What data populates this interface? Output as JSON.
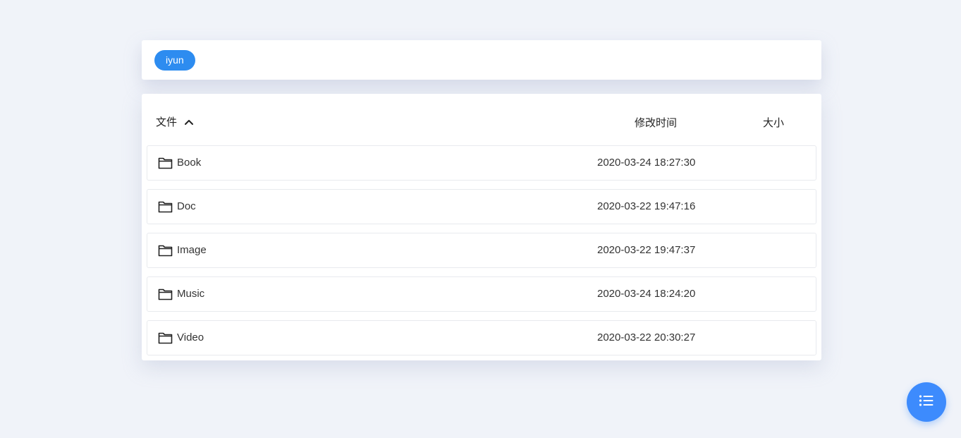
{
  "breadcrumb": {
    "items": [
      {
        "label": "iyun"
      }
    ]
  },
  "table": {
    "headers": {
      "name": "文件",
      "modified": "修改时间",
      "size": "大小"
    },
    "sort": {
      "column": "name",
      "direction": "asc"
    },
    "rows": [
      {
        "name": "Book",
        "modified": "2020-03-24 18:27:30",
        "size": "",
        "type": "folder"
      },
      {
        "name": "Doc",
        "modified": "2020-03-22 19:47:16",
        "size": "",
        "type": "folder"
      },
      {
        "name": "Image",
        "modified": "2020-03-22 19:47:37",
        "size": "",
        "type": "folder"
      },
      {
        "name": "Music",
        "modified": "2020-03-24 18:24:20",
        "size": "",
        "type": "folder"
      },
      {
        "name": "Video",
        "modified": "2020-03-22 20:30:27",
        "size": "",
        "type": "folder"
      }
    ]
  },
  "fab": {
    "icon": "list-icon"
  },
  "colors": {
    "accent": "#2d8cf0",
    "fab": "#3d8bfd",
    "background": "#f0f3f9"
  }
}
